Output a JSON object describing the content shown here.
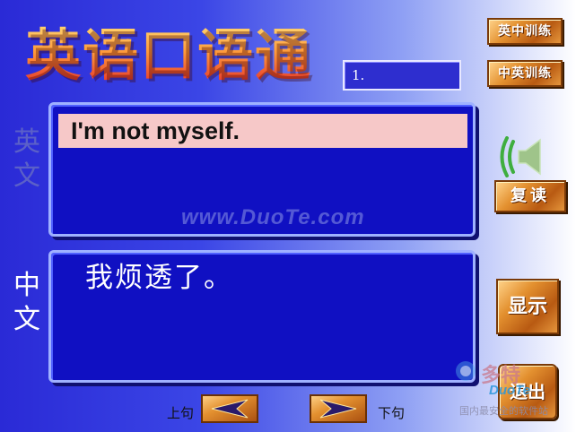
{
  "header": {
    "title": "英语口语通"
  },
  "sentence": {
    "number": "1."
  },
  "labels": {
    "english": "英文",
    "chinese": "中文"
  },
  "content": {
    "english": "I'm not myself.",
    "chinese": "我烦透了。",
    "watermark": "www.DuoTe.com"
  },
  "buttons": {
    "en_zh_training": "英中训练",
    "zh_en_training": "中英训练",
    "repeat": "复读",
    "show": "显示",
    "exit": "退出"
  },
  "nav": {
    "prev_label": "上句",
    "next_label": "下句"
  },
  "site_logo": {
    "name": "多特",
    "latin": "DuoTe",
    "tagline": "国内最安全的软件站"
  },
  "colors": {
    "background_blue": "#2a2ad6",
    "panel_blue": "#1010c2",
    "highlight_pink": "#f6c8c8",
    "wood": "#e3902f"
  }
}
